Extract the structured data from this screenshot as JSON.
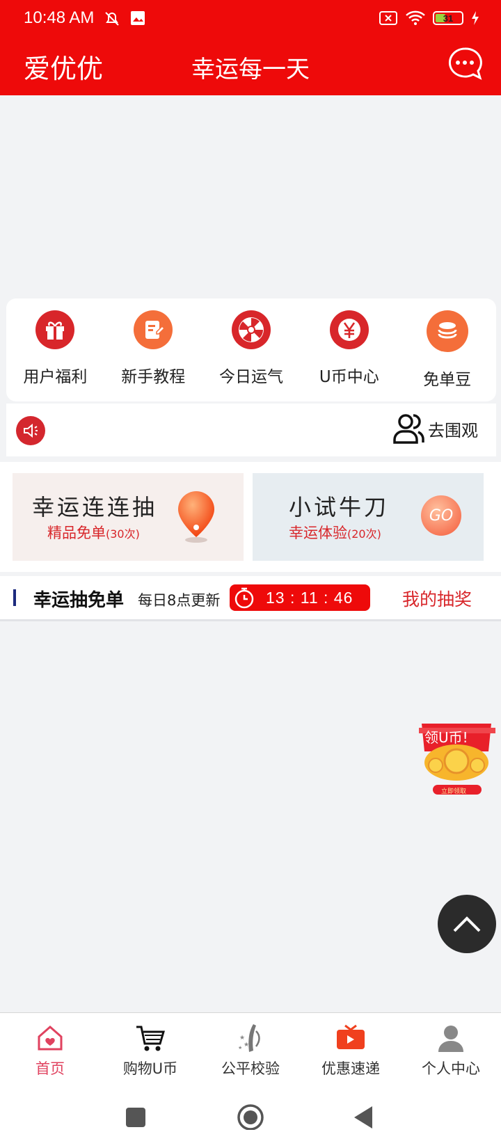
{
  "status": {
    "time": "10:48 AM",
    "battery": "31"
  },
  "header": {
    "app_name": "爱优优",
    "title": "幸运每一天"
  },
  "quick_menu": [
    {
      "label": "用户福利",
      "icon": "gift-icon",
      "color": "#d8262a"
    },
    {
      "label": "新手教程",
      "icon": "tutorial-icon",
      "color": "#f46e3a"
    },
    {
      "label": "今日运气",
      "icon": "wheel-icon",
      "color": "#d8262a"
    },
    {
      "label": "U币中心",
      "icon": "yen-icon",
      "color": "#d8262a"
    },
    {
      "label": "免单豆",
      "icon": "coins-icon",
      "color": "#f46e3a"
    }
  ],
  "notice": {
    "crowd_label": "去围观"
  },
  "promos": [
    {
      "title": "幸运连连抽",
      "subtitle": "精品免单",
      "count": "(30次)"
    },
    {
      "title": "小试牛刀",
      "subtitle": "幸运体验",
      "count": "(20次)",
      "go": "GO"
    }
  ],
  "lucky_draw": {
    "title": "幸运抽免单",
    "note": "每日8点更新",
    "countdown": "13 : 11 : 46",
    "my_prize": "我的抽奖"
  },
  "float_coin": {
    "label": "领U币!",
    "sub": "立即领取"
  },
  "bottom_nav": [
    {
      "label": "首页",
      "icon": "home-icon",
      "active": true
    },
    {
      "label": "购物U币",
      "icon": "cart-icon",
      "active": false
    },
    {
      "label": "公平校验",
      "icon": "verify-icon",
      "active": false
    },
    {
      "label": "优惠速递",
      "icon": "video-icon",
      "active": false
    },
    {
      "label": "个人中心",
      "icon": "person-icon",
      "active": false
    }
  ],
  "colors": {
    "brand": "#ee0a0a",
    "accent": "#d8262a",
    "orange": "#f46e3a",
    "active_tab": "#e0425f"
  }
}
